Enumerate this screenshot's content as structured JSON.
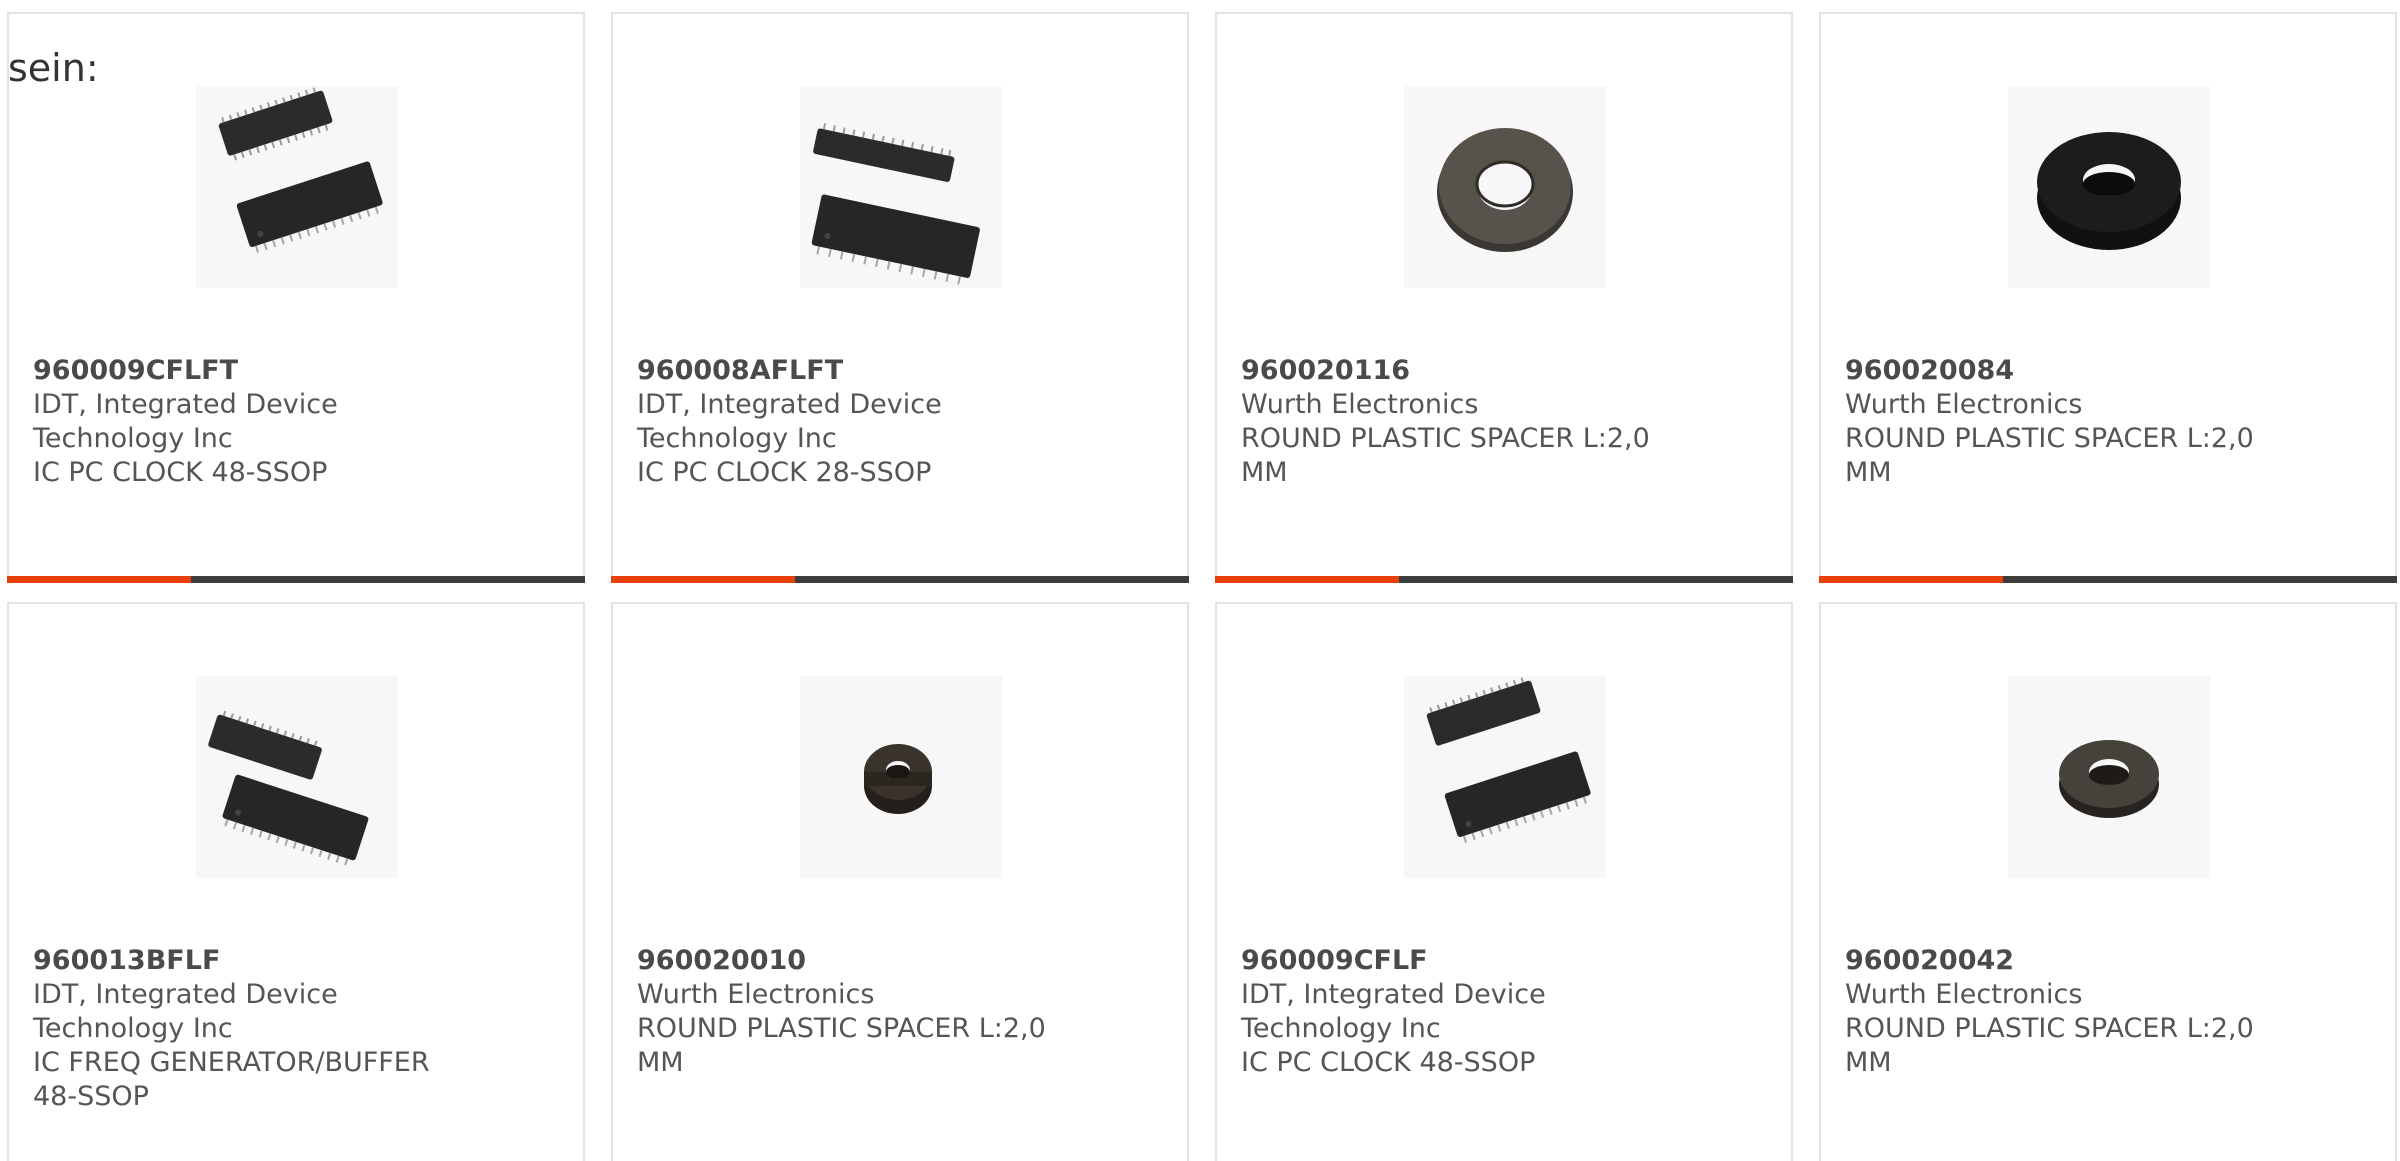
{
  "prefix_text": "sein:",
  "colors": {
    "accent": "#e8400c",
    "bar_dark": "#3d3d3d",
    "card_border": "#e2e2e2",
    "text": "#555555"
  },
  "products": [
    {
      "part_number": "960009CFLFT",
      "manufacturer_line1": "IDT, Integrated Device",
      "manufacturer_line2": "Technology Inc",
      "description_line1": "IC PC CLOCK 48-SSOP",
      "description_line2": "",
      "image": "ssop-chip-icon"
    },
    {
      "part_number": "960008AFLFT",
      "manufacturer_line1": "IDT, Integrated Device",
      "manufacturer_line2": "Technology Inc",
      "description_line1": "IC PC CLOCK 28-SSOP",
      "description_line2": "",
      "image": "ssop-chip-icon"
    },
    {
      "part_number": "960020116",
      "manufacturer_line1": "Wurth Electronics",
      "manufacturer_line2": "",
      "description_line1": "ROUND PLASTIC SPACER L:2,0",
      "description_line2": "MM",
      "image": "round-spacer-icon"
    },
    {
      "part_number": "960020084",
      "manufacturer_line1": "Wurth Electronics",
      "manufacturer_line2": "",
      "description_line1": "ROUND PLASTIC SPACER L:2,0",
      "description_line2": "MM",
      "image": "round-spacer-icon"
    },
    {
      "part_number": "960013BFLF",
      "manufacturer_line1": "IDT, Integrated Device",
      "manufacturer_line2": "Technology Inc",
      "description_line1": "IC FREQ GENERATOR/BUFFER",
      "description_line2": "48-SSOP",
      "image": "ssop-chip-icon"
    },
    {
      "part_number": "960020010",
      "manufacturer_line1": "Wurth Electronics",
      "manufacturer_line2": "",
      "description_line1": "ROUND PLASTIC SPACER L:2,0",
      "description_line2": "MM",
      "image": "round-spacer-icon"
    },
    {
      "part_number": "960009CFLF",
      "manufacturer_line1": "IDT, Integrated Device",
      "manufacturer_line2": "Technology Inc",
      "description_line1": "IC PC CLOCK 48-SSOP",
      "description_line2": "",
      "image": "ssop-chip-icon"
    },
    {
      "part_number": "960020042",
      "manufacturer_line1": "Wurth Electronics",
      "manufacturer_line2": "",
      "description_line1": "ROUND PLASTIC SPACER L:2,0",
      "description_line2": "MM",
      "image": "round-spacer-icon"
    }
  ]
}
